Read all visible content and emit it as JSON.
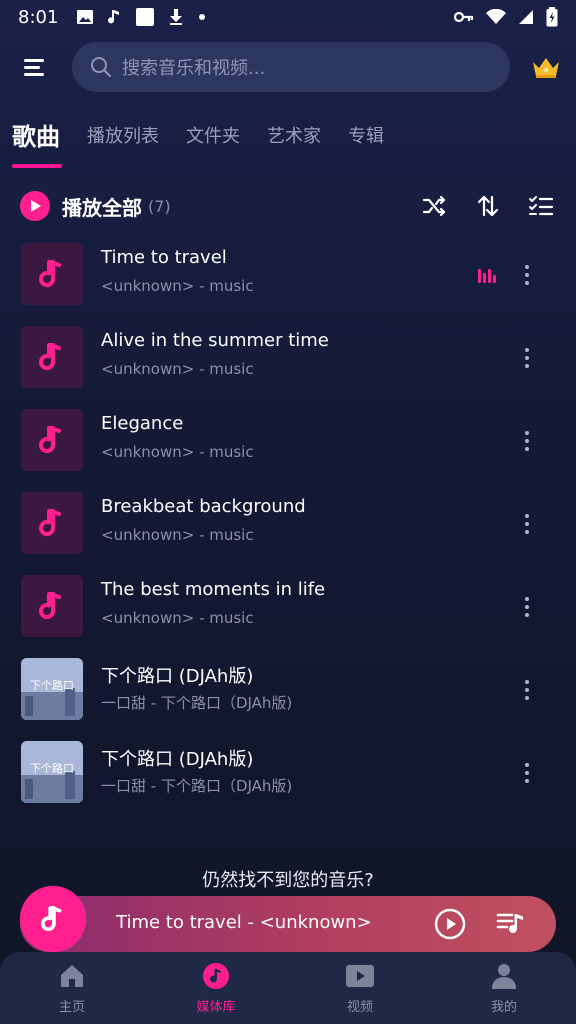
{
  "status": {
    "time": "8:01"
  },
  "search": {
    "placeholder": "搜索音乐和视频..."
  },
  "tabs": [
    {
      "label": "歌曲",
      "active": true
    },
    {
      "label": "播放列表"
    },
    {
      "label": "文件夹"
    },
    {
      "label": "艺术家"
    },
    {
      "label": "专辑"
    }
  ],
  "play_all": {
    "label": "播放全部",
    "count": "(7)"
  },
  "songs": [
    {
      "title": "Time to travel",
      "subtitle": "<unknown> - music",
      "playing": true,
      "art": "note"
    },
    {
      "title": "Alive in the summer time",
      "subtitle": "<unknown> - music",
      "art": "note"
    },
    {
      "title": "Elegance",
      "subtitle": "<unknown> - music",
      "art": "note"
    },
    {
      "title": "Breakbeat background",
      "subtitle": "<unknown> - music",
      "art": "note"
    },
    {
      "title": "The best moments in life",
      "subtitle": "<unknown> - music",
      "art": "note"
    },
    {
      "title": "下个路口 (DJAh版)",
      "subtitle": "一口甜 - 下个路口（DJAh版)",
      "art": "cover",
      "cover_text": "下个路口"
    },
    {
      "title": "下个路口 (DJAh版)",
      "subtitle": "一口甜 - 下个路口（DJAh版)",
      "art": "cover",
      "cover_text": "下个路口"
    }
  ],
  "not_found": "仍然找不到您的音乐?",
  "mini_player": {
    "text": "Time to travel - <unknown>"
  },
  "nav": [
    {
      "label": "主页",
      "icon": "home-icon"
    },
    {
      "label": "媒体库",
      "icon": "music-library-icon",
      "active": true
    },
    {
      "label": "视频",
      "icon": "video-icon"
    },
    {
      "label": "我的",
      "icon": "profile-icon"
    }
  ],
  "colors": {
    "accent": "#ff1f8f",
    "background": "#141a36",
    "search": "#2c375f"
  }
}
